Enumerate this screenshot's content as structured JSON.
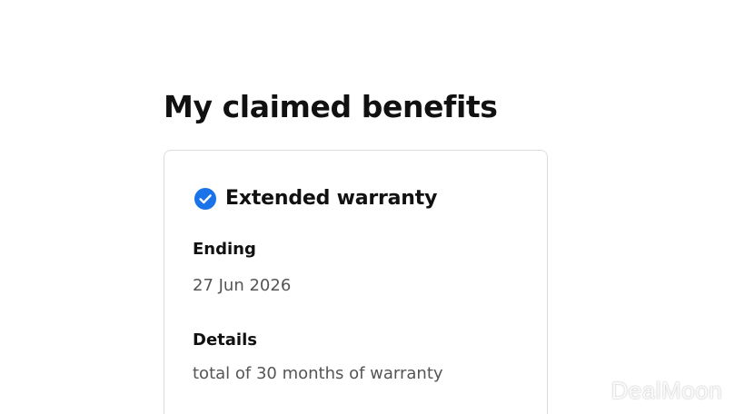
{
  "page": {
    "title": "My claimed benefits"
  },
  "benefit": {
    "icon": "check-circle-icon",
    "icon_color": "#1a73e8",
    "title": "Extended warranty",
    "ending_label": "Ending",
    "ending_value": "27 Jun 2026",
    "details_label": "Details",
    "details_value": "total of 30 months of warranty"
  },
  "watermark": {
    "text": "DealMoon"
  }
}
